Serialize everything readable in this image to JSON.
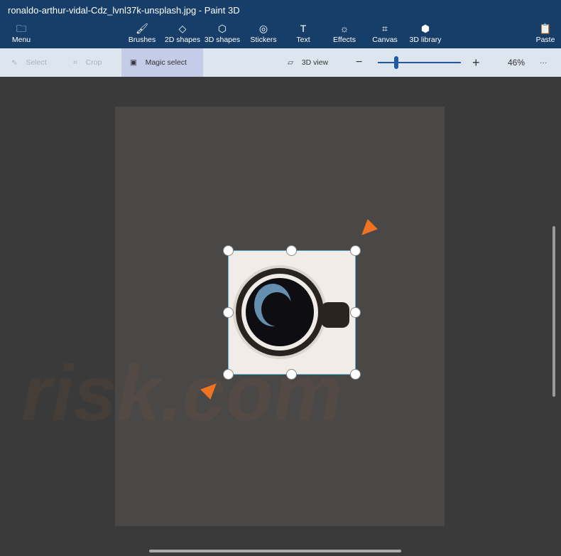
{
  "window": {
    "title": "ronaldo-arthur-vidal-Cdz_lvnl37k-unsplash.jpg - Paint 3D"
  },
  "ribbon": {
    "menu": "Menu",
    "items": [
      "Brushes",
      "2D shapes",
      "3D shapes",
      "Stickers",
      "Text",
      "Effects",
      "Canvas",
      "3D library"
    ],
    "paste": "Paste"
  },
  "toolbar": {
    "select": "Select",
    "crop": "Crop",
    "magic_select": "Magic select",
    "view_3d": "3D view",
    "zoom_minus": "−",
    "zoom_plus": "+",
    "zoom_level": "46%",
    "more": "···",
    "zoom_slider_fraction": 0.22
  },
  "watermark": "risk.com",
  "colors": {
    "titlebar": "#163e68",
    "accent": "#ef7320",
    "selection": "#5ab0d8"
  }
}
